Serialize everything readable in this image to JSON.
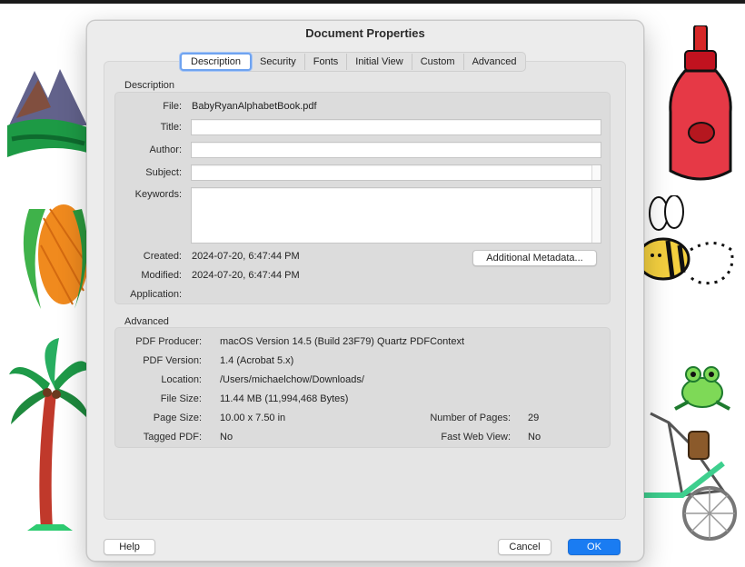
{
  "dialog": {
    "title": "Document Properties"
  },
  "tabs": [
    {
      "label": "Description"
    },
    {
      "label": "Security"
    },
    {
      "label": "Fonts"
    },
    {
      "label": "Initial View"
    },
    {
      "label": "Custom"
    },
    {
      "label": "Advanced"
    }
  ],
  "description": {
    "section_label": "Description",
    "file_label": "File:",
    "file_value": "BabyRyanAlphabetBook.pdf",
    "title_label": "Title:",
    "title_value": "",
    "author_label": "Author:",
    "author_value": "",
    "subject_label": "Subject:",
    "subject_value": "",
    "keywords_label": "Keywords:",
    "keywords_value": "",
    "created_label": "Created:",
    "created_value": "2024-07-20, 6:47:44 PM",
    "modified_label": "Modified:",
    "modified_value": "2024-07-20, 6:47:44 PM",
    "application_label": "Application:",
    "application_value": "",
    "metadata_button": "Additional Metadata..."
  },
  "advanced": {
    "section_label": "Advanced",
    "producer_label": "PDF Producer:",
    "producer_value": "macOS Version 14.5 (Build 23F79) Quartz PDFContext",
    "version_label": "PDF Version:",
    "version_value": "1.4 (Acrobat 5.x)",
    "location_label": "Location:",
    "location_value": "/Users/michaelchow/Downloads/",
    "filesize_label": "File Size:",
    "filesize_value": "11.44 MB (11,994,468 Bytes)",
    "pagesize_label": "Page Size:",
    "pagesize_value": "10.00 x 7.50 in",
    "pages_label": "Number of Pages:",
    "pages_value": "29",
    "tagged_label": "Tagged PDF:",
    "tagged_value": "No",
    "fastweb_label": "Fast Web View:",
    "fastweb_value": "No"
  },
  "buttons": {
    "help": "Help",
    "cancel": "Cancel",
    "ok": "OK"
  },
  "colors": {
    "accent": "#1a7cf2",
    "focus_ring": "#6fa3f0",
    "dialog_bg": "#ececec"
  }
}
